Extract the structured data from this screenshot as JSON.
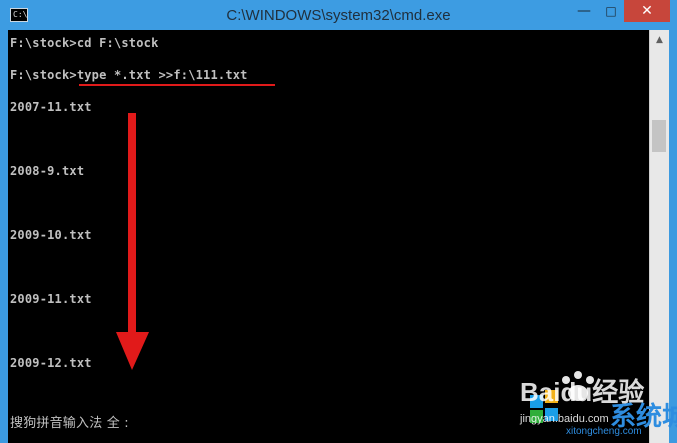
{
  "window": {
    "title": "C:\\WINDOWS\\system32\\cmd.exe",
    "icon_text": "C:\\",
    "minimize": "—",
    "maximize": "□",
    "close": "✕"
  },
  "console": {
    "lines": [
      "F:\\stock>cd F:\\stock",
      "F:\\stock>type *.txt >>f:\\111.txt",
      "2007-11.txt",
      "2008-9.txt",
      "2009-10.txt",
      "2009-11.txt",
      "2009-12.txt"
    ],
    "ime_status": "搜狗拼音输入法 全 :"
  },
  "scrollbar": {
    "up_arrow": "▲"
  },
  "watermark": {
    "brand": "Baidu经验",
    "url": "jingyan.baidu.com",
    "site_brand": "系统城",
    "site_url": "xitongcheng.com"
  },
  "colors": {
    "titlebar": "#3d9ce2",
    "console_bg": "#000000",
    "console_text": "#c0c0c0",
    "annotation": "#e11a1a",
    "close_button": "#c7463b"
  }
}
